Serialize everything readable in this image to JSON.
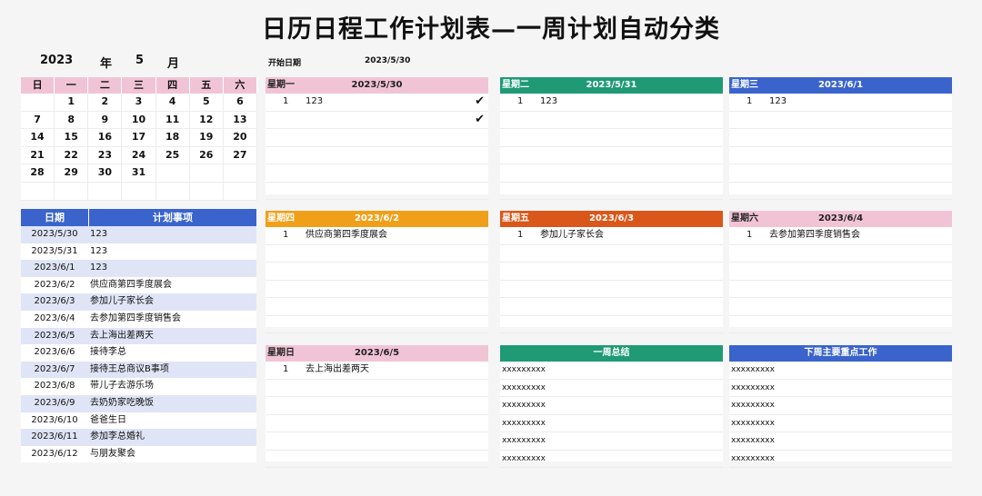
{
  "title": "日历日程工作计划表—一周计划自动分类",
  "year": "2023",
  "year_unit": "年",
  "month": "5",
  "month_unit": "月",
  "start_label": "开始日期",
  "start_value": "2023/5/30",
  "calendar": {
    "weekdays": [
      "日",
      "一",
      "二",
      "三",
      "四",
      "五",
      "六"
    ],
    "rows": [
      [
        "",
        "1",
        "2",
        "3",
        "4",
        "5",
        "6"
      ],
      [
        "7",
        "8",
        "9",
        "10",
        "11",
        "12",
        "13"
      ],
      [
        "14",
        "15",
        "16",
        "17",
        "18",
        "19",
        "20"
      ],
      [
        "21",
        "22",
        "23",
        "24",
        "25",
        "26",
        "27"
      ],
      [
        "28",
        "29",
        "30",
        "31",
        "",
        "",
        ""
      ],
      [
        "",
        "",
        "",
        "",
        "",
        "",
        ""
      ]
    ]
  },
  "schedule": {
    "headers": [
      "日期",
      "计划事项"
    ],
    "rows": [
      [
        "2023/5/30",
        "123"
      ],
      [
        "2023/5/31",
        "123"
      ],
      [
        "2023/6/1",
        "123"
      ],
      [
        "2023/6/2",
        "供应商第四季度展会"
      ],
      [
        "2023/6/3",
        "参加儿子家长会"
      ],
      [
        "2023/6/4",
        "去参加第四季度销售会"
      ],
      [
        "2023/6/5",
        "去上海出差两天"
      ],
      [
        "2023/6/6",
        "接待李总"
      ],
      [
        "2023/6/7",
        "接待王总商议B事项"
      ],
      [
        "2023/6/8",
        "带儿子去游乐场"
      ],
      [
        "2023/6/9",
        "去奶奶家吃晚饭"
      ],
      [
        "2023/6/10",
        "爸爸生日"
      ],
      [
        "2023/6/11",
        "参加李总婚礼"
      ],
      [
        "2023/6/12",
        "与朋友聚会"
      ]
    ]
  },
  "days": [
    {
      "weekday": "星期一",
      "date": "2023/5/30",
      "color": "#f1c4d5",
      "dark": true,
      "items": [
        {
          "n": "1",
          "t": "123",
          "check": "✔"
        },
        {
          "n": "",
          "t": "",
          "check": "✔"
        }
      ]
    },
    {
      "weekday": "星期二",
      "date": "2023/5/31",
      "color": "#1f9a75",
      "dark": false,
      "items": [
        {
          "n": "1",
          "t": "123",
          "check": ""
        }
      ]
    },
    {
      "weekday": "星期三",
      "date": "2023/6/1",
      "color": "#3a64cc",
      "dark": false,
      "items": [
        {
          "n": "1",
          "t": "123",
          "check": ""
        }
      ]
    },
    {
      "weekday": "星期四",
      "date": "2023/6/2",
      "color": "#f0a018",
      "dark": false,
      "items": [
        {
          "n": "1",
          "t": "供应商第四季度展会",
          "check": ""
        }
      ]
    },
    {
      "weekday": "星期五",
      "date": "2023/6/3",
      "color": "#d9571a",
      "dark": false,
      "items": [
        {
          "n": "1",
          "t": "参加儿子家长会",
          "check": ""
        }
      ]
    },
    {
      "weekday": "星期六",
      "date": "2023/6/4",
      "color": "#f1c4d5",
      "dark": true,
      "items": [
        {
          "n": "1",
          "t": "去参加第四季度销售会",
          "check": ""
        }
      ]
    },
    {
      "weekday": "星期日",
      "date": "2023/6/5",
      "color": "#f1c4d5",
      "dark": true,
      "items": [
        {
          "n": "1",
          "t": "去上海出差两天",
          "check": ""
        }
      ]
    }
  ],
  "week_summary": {
    "title": "一周总结",
    "color": "#1f9a75",
    "rows": [
      "xxxxxxxxx",
      "xxxxxxxxx",
      "xxxxxxxxx",
      "xxxxxxxxx",
      "xxxxxxxxx",
      "xxxxxxxxx"
    ]
  },
  "next_week": {
    "title": "下周主要重点工作",
    "color": "#3a64cc",
    "rows": [
      "xxxxxxxxx",
      "xxxxxxxxx",
      "xxxxxxxxx",
      "xxxxxxxxx",
      "xxxxxxxxx",
      "xxxxxxxxx"
    ]
  }
}
